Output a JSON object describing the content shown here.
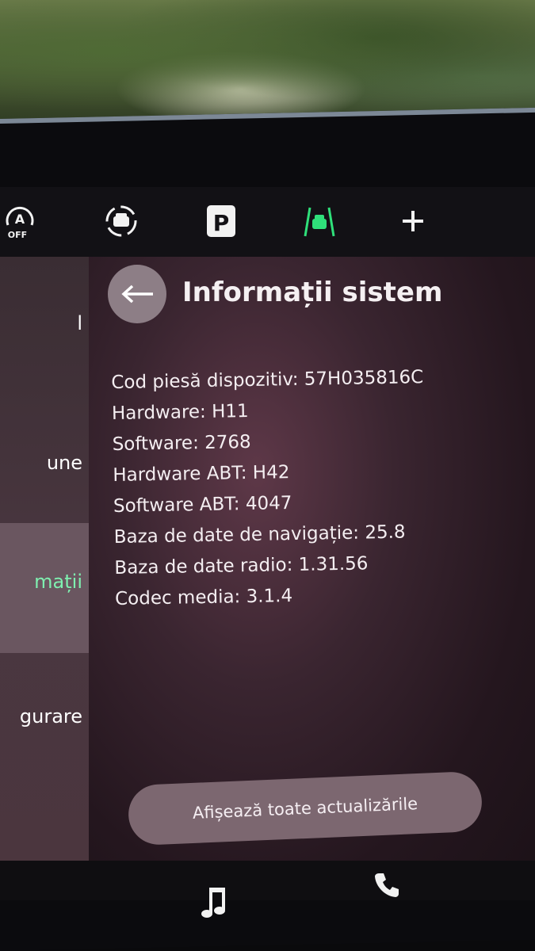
{
  "topbar": {
    "icons": [
      {
        "name": "auto-start-stop-off-icon",
        "label": "OFF"
      },
      {
        "name": "driver-assist-icon"
      },
      {
        "name": "parking-icon",
        "label": "P"
      },
      {
        "name": "lane-assist-icon",
        "color": "#2fe07a"
      },
      {
        "name": "add-icon"
      }
    ]
  },
  "sidebar": {
    "items": [
      {
        "label": "l"
      },
      {
        "label": "une"
      },
      {
        "label": "mații",
        "active": true
      },
      {
        "label": "gurare"
      }
    ]
  },
  "header": {
    "title": "Informații sistem"
  },
  "info": {
    "lines": [
      "Cod piesă dispozitiv: 57H035816C",
      "Hardware: H11",
      "Software: 2768",
      "Hardware ABT: H42",
      "Software ABT: 4047",
      "Baza de date de navigație: 25.8",
      "Baza de date radio: 1.31.56",
      "Codec media: 3.1.4"
    ]
  },
  "actions": {
    "show_updates_label": "Afișează toate actualizările"
  },
  "colors": {
    "accent_green": "#2fe07a",
    "active_text": "#7ff0b0"
  }
}
